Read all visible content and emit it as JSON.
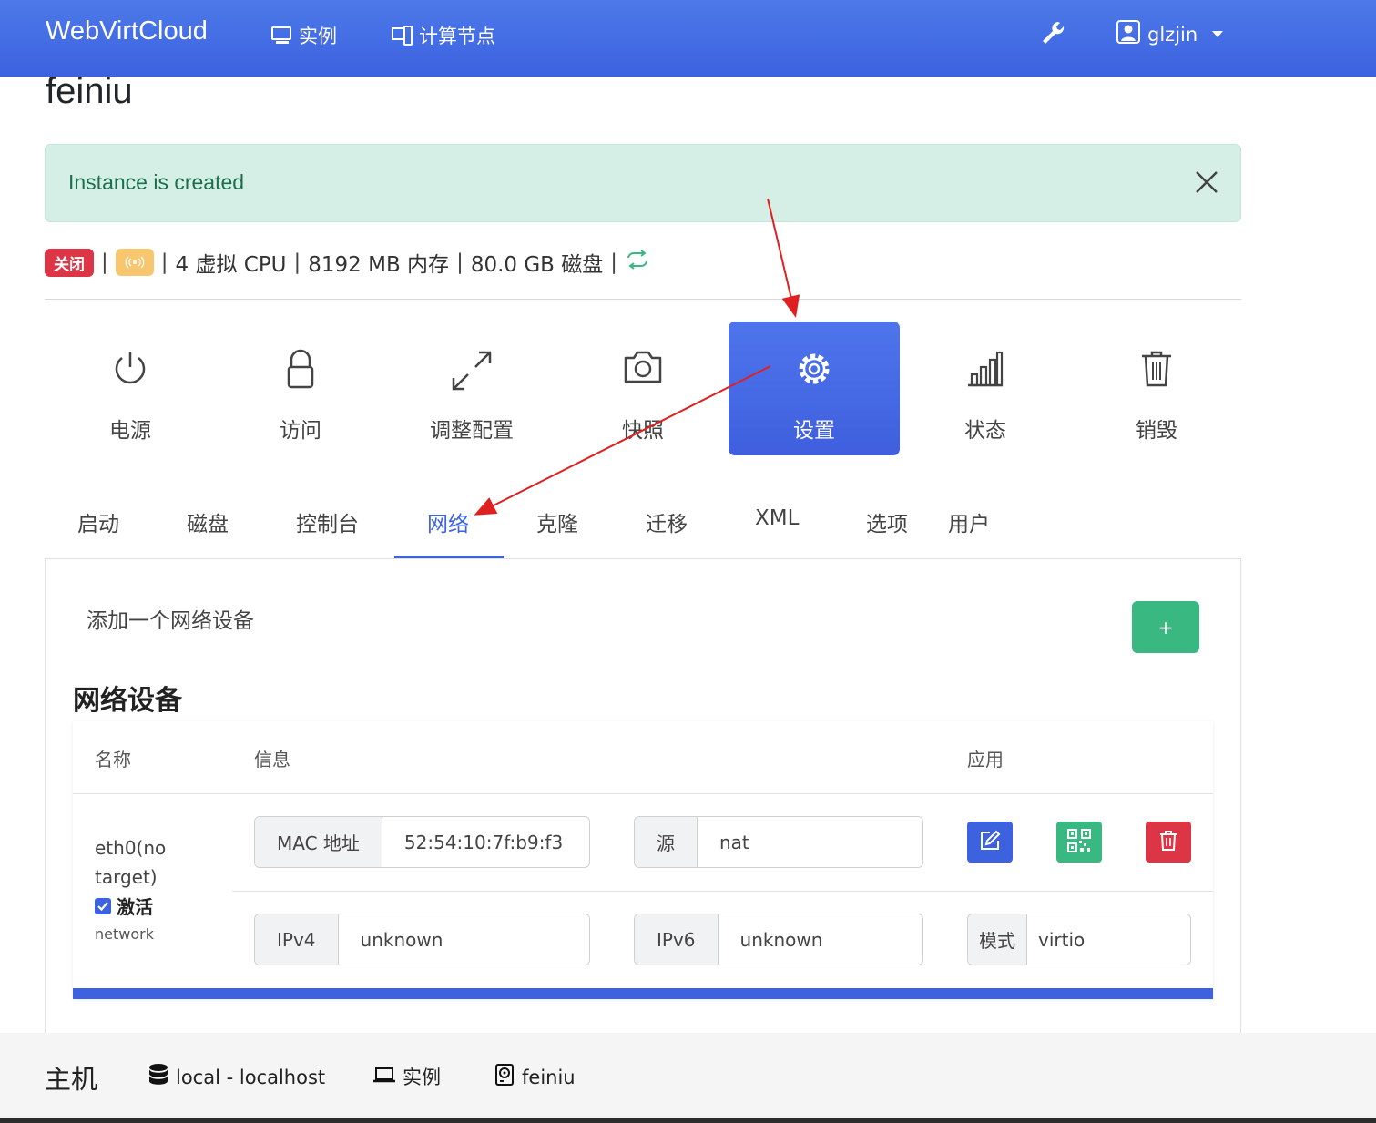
{
  "navbar": {
    "brand": "WebVirtCloud",
    "links": [
      {
        "label": "实例",
        "icon": "monitor-icon"
      },
      {
        "label": "计算节点",
        "icon": "server-icon"
      }
    ],
    "tools_icon": "wrench-icon",
    "user": {
      "name": "glzjin",
      "icon": "user-icon"
    },
    "colors": {
      "bg": "#3d62e0",
      "text": "#ffffff"
    }
  },
  "instance": {
    "name": "feiniu",
    "alert": "Instance is created",
    "status_badge": "关闭",
    "specs": [
      "4 虚拟 CPU",
      "8192 MB 内存",
      "80.0 GB 磁盘"
    ]
  },
  "actions": [
    {
      "label": "电源",
      "icon": "power-icon"
    },
    {
      "label": "访问",
      "icon": "lock-icon"
    },
    {
      "label": "调整配置",
      "icon": "resize-icon"
    },
    {
      "label": "快照",
      "icon": "camera-icon"
    },
    {
      "label": "设置",
      "icon": "gear-icon",
      "active": true
    },
    {
      "label": "状态",
      "icon": "bar-chart-icon"
    },
    {
      "label": "销毁",
      "icon": "trash-icon"
    }
  ],
  "tabs": [
    "启动",
    "磁盘",
    "控制台",
    "网络",
    "克隆",
    "迁移",
    "XML",
    "选项",
    "用户"
  ],
  "active_tab": "网络",
  "network": {
    "add_label": "添加一个网络设备",
    "add_button": "+",
    "section_title": "网络设备",
    "columns": {
      "name": "名称",
      "info": "信息",
      "apply": "应用"
    },
    "interface": {
      "name": "eth0(no target)",
      "active_label": "激活",
      "active_checked": true,
      "type": "network",
      "mac_label": "MAC 地址",
      "mac": "52:54:10:7f:b9:f3",
      "source_label": "源",
      "source": "nat",
      "ipv4_label": "IPv4",
      "ipv4": "unknown",
      "ipv6_label": "IPv6",
      "ipv6": "unknown",
      "mode_label": "模式",
      "mode": "virtio"
    }
  },
  "footer": {
    "host_label": "主机",
    "breadcrumbs": [
      {
        "label": "local - localhost",
        "icon": "database-icon"
      },
      {
        "label": "实例",
        "icon": "laptop-icon"
      },
      {
        "label": "feiniu",
        "icon": "hdd-icon"
      }
    ]
  },
  "colors": {
    "primary": "#3d62e0",
    "success": "#3ab882",
    "danger": "#dc3545",
    "warning": "#f7c66e",
    "alert_bg": "#d5efe6",
    "annotation_arrow": "#e02020"
  }
}
